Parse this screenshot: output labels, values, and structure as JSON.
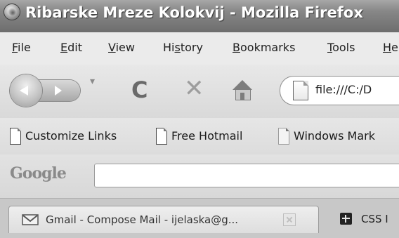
{
  "window": {
    "title": "Ribarske Mreze Kolokvij - Mozilla Firefox"
  },
  "menu": {
    "items": [
      {
        "mnemonic": "F",
        "rest": "ile"
      },
      {
        "mnemonic": "E",
        "rest": "dit"
      },
      {
        "mnemonic": "V",
        "rest": "iew"
      },
      {
        "pre": "Hi",
        "mnemonic": "s",
        "rest": "tory"
      },
      {
        "mnemonic": "B",
        "rest": "ookmarks"
      },
      {
        "mnemonic": "T",
        "rest": "ools"
      },
      {
        "mnemonic": "H",
        "rest": "e"
      }
    ]
  },
  "navigation": {
    "url_value": "file:///C:/D",
    "icons": [
      "back-icon",
      "forward-icon",
      "history-dropdown-icon",
      "reload-icon",
      "stop-icon",
      "home-icon",
      "page-icon"
    ]
  },
  "bookmarks": {
    "items": [
      {
        "label": "Customize Links"
      },
      {
        "label": "Free Hotmail"
      },
      {
        "label": "Windows Mark"
      }
    ]
  },
  "search": {
    "engine": "Google",
    "value": ""
  },
  "tabs": [
    {
      "label": "Gmail - Compose Mail - ijelaska@g...",
      "icon": "gmail-icon",
      "active": true
    },
    {
      "label": "CSS I",
      "icon": "css-icon",
      "active": false
    }
  ]
}
